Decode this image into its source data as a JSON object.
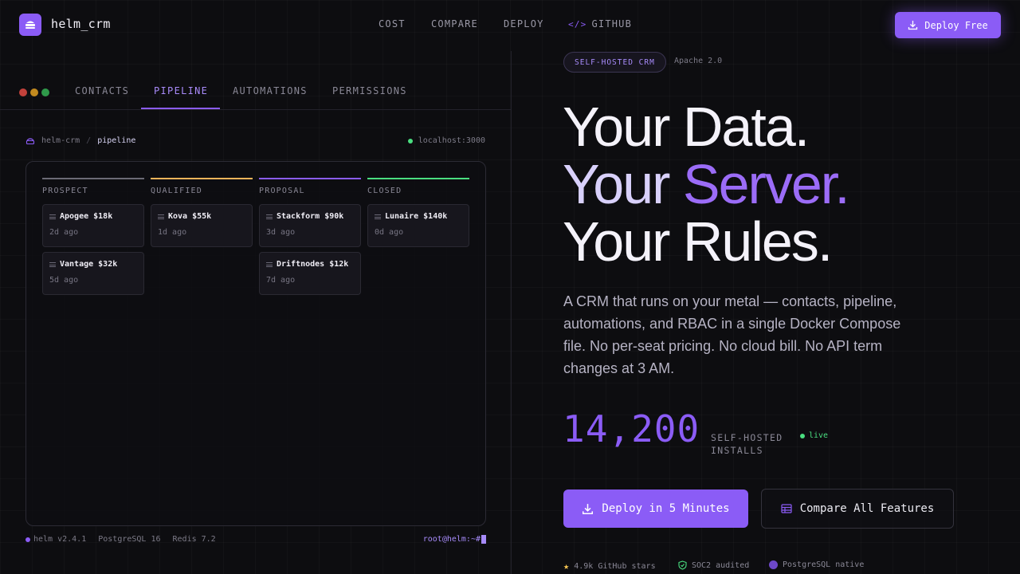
{
  "brand": {
    "name": "helm_crm",
    "accent": "#8b5cf6"
  },
  "nav": {
    "cost": "COST",
    "compare": "COMPARE",
    "deploy": "DEPLOY",
    "github": "GITHUB"
  },
  "top_cta": "Deploy Free",
  "app_preview": {
    "tabs": [
      "CONTACTS",
      "PIPELINE",
      "AUTOMATIONS",
      "PERMISSIONS"
    ],
    "active_tab": "PIPELINE",
    "breadcrumb": {
      "root": "helm-crm",
      "current": "pipeline"
    },
    "host": "localhost:3000",
    "columns": [
      {
        "title": "PROSPECT",
        "color": "#6b6a75",
        "cards": [
          {
            "name": "Apogee $18k",
            "age": "2d ago"
          },
          {
            "name": "Vantage $32k",
            "age": "5d ago"
          }
        ]
      },
      {
        "title": "QUALIFIED",
        "color": "#f0b45a",
        "cards": [
          {
            "name": "Kova $55k",
            "age": "1d ago"
          }
        ]
      },
      {
        "title": "PROPOSAL",
        "color": "#8b5cf6",
        "cards": [
          {
            "name": "Stackform $90k",
            "age": "3d ago"
          },
          {
            "name": "Driftnodes $12k",
            "age": "7d ago"
          }
        ]
      },
      {
        "title": "CLOSED",
        "color": "#4ade80",
        "cards": [
          {
            "name": "Lunaire $140k",
            "age": "0d ago"
          }
        ]
      }
    ],
    "status": {
      "version": "helm v2.4.1",
      "db": "PostgreSQL 16",
      "cache": "Redis 7.2",
      "prompt": "root@helm:~#"
    }
  },
  "hero": {
    "badge": "SELF-HOSTED CRM",
    "license": "Apache 2.0",
    "line1": "Your Data.",
    "line2a": "Your ",
    "line2b": "Server.",
    "line3": "Your Rules.",
    "lede": "A CRM that runs on your metal — contacts, pipeline, automations, and RBAC in a single Docker Compose file. No per-seat pricing. No cloud bill. No API term changes at 3 AM.",
    "metric_value": "14,200",
    "metric_label_1": "SELF-HOSTED",
    "metric_label_2": "INSTALLS",
    "live": "live",
    "cta_primary": "Deploy in 5 Minutes",
    "cta_secondary": "Compare All Features",
    "trust": {
      "stars": "4.9k GitHub stars",
      "soc2": "SOC2 audited",
      "pg": "PostgreSQL native"
    }
  }
}
